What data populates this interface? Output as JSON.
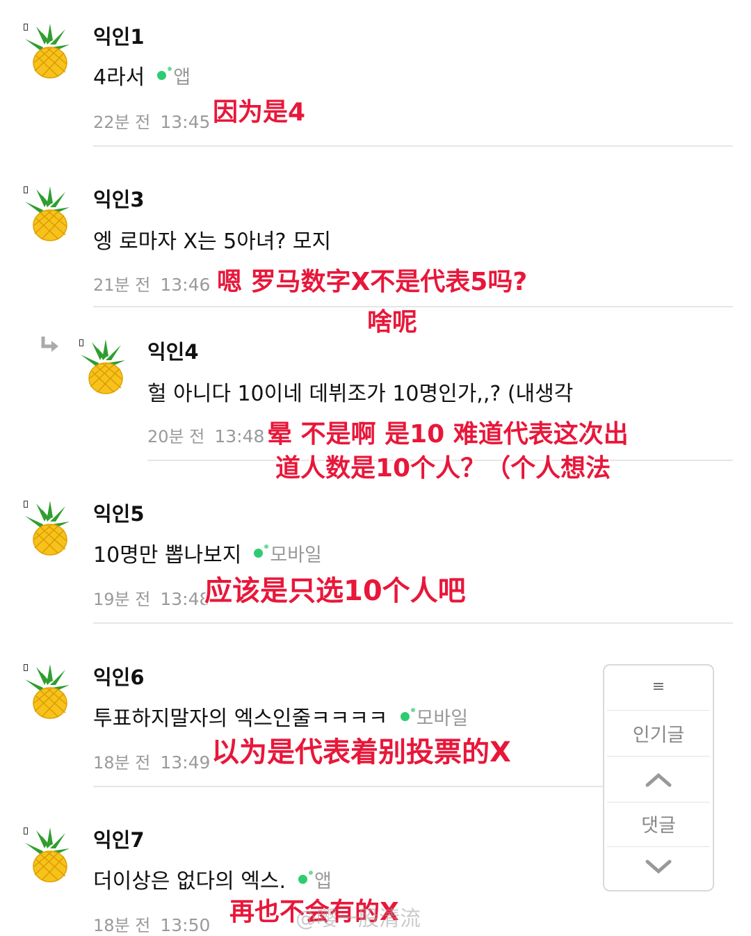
{
  "comments": [
    {
      "author": "익인1",
      "text": "4라서",
      "device": "앱",
      "time_ago": "22분 전",
      "time": "13:45",
      "translation": [
        "因为是4"
      ]
    },
    {
      "author": "익인3",
      "text": "엥 로마자 X는 5아녀? 모지",
      "device": "",
      "time_ago": "21분 전",
      "time": "13:46",
      "translation": [
        "嗯 罗马数字X不是代表5吗?",
        "啥呢"
      ]
    },
    {
      "author": "익인4",
      "text": "헐 아니다 10이네 데뷔조가 10명인가,,? (내생각",
      "device": "",
      "time_ago": "20분 전",
      "time": "13:48",
      "translation": [
        "晕 不是啊 是10 难道代表这次出",
        "道人数是10个人？（个人想法"
      ]
    },
    {
      "author": "익인5",
      "text": "10명만 뽑나보지",
      "device": "모바일",
      "time_ago": "19분 전",
      "time": "13:48",
      "translation": [
        "应该是只选10个人吧"
      ]
    },
    {
      "author": "익인6",
      "text": "투표하지말자의 엑스인줄ㅋㅋㅋㅋ",
      "device": "모바일",
      "time_ago": "18분 전",
      "time": "13:49",
      "translation": [
        "以为是代表着别投票的X"
      ]
    },
    {
      "author": "익인7",
      "text": "더이상은 없다의 엑스.",
      "device": "앱",
      "time_ago": "18분 전",
      "time": "13:50",
      "translation": [
        "再也不会有的X"
      ]
    }
  ],
  "side_nav": {
    "menu_icon": "≡",
    "popular_label": "인기글",
    "up_icon": "chevron-up",
    "comments_label": "댓글",
    "down_icon": "chevron-down"
  },
  "watermark": "@嘤一股清流",
  "colors": {
    "translation": "#e8173a",
    "online_dot": "#2ecc71",
    "muted": "#999999"
  }
}
